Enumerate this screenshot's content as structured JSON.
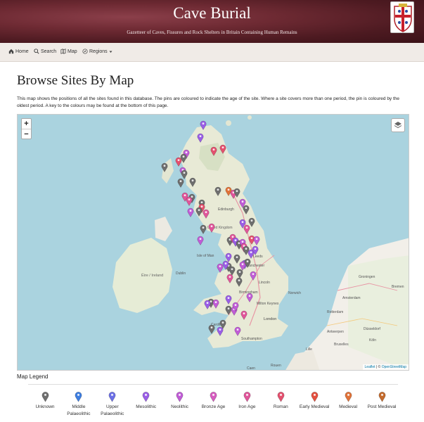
{
  "header": {
    "title": "Cave Burial",
    "subtitle": "Gazetteer of Caves, Fissures and Rock Shelters in Britain Containing Human Remains"
  },
  "nav": {
    "home": "Home",
    "search": "Search",
    "map": "Map",
    "regions": "Regions"
  },
  "page": {
    "title": "Browse Sites By Map",
    "intro": "This map shows the positions of all the sites found in this database. The pins are coloured to indicate the age of the site. Where a site covers more than one period, the pin is coloured by the oldest period. A key to the colours may be found at the bottom of this page."
  },
  "map": {
    "zoom_in": "+",
    "zoom_out": "−",
    "attribution_leaflet": "Leaflet",
    "attribution_sep": " | © ",
    "attribution_osm": "OpenStreetMap",
    "place_labels": [
      "Edinburgh",
      "United Kingdom",
      "Isle of Man",
      "Éire / Ireland",
      "Dublin",
      "Leeds",
      "Manchester",
      "Lincoln",
      "Birmingham",
      "Milton Keynes",
      "London",
      "Southampton",
      "Cardiff",
      "Norwich",
      "Groningen",
      "Bremen",
      "Amsterdam",
      "Rotterdam",
      "Antwerpen",
      "Bruxelles",
      "Düsseldorf",
      "Köln",
      "Lille",
      "Rouen",
      "Caen"
    ],
    "pins": [
      {
        "period": "mesolithic"
      },
      {
        "period": "mesolithic"
      },
      {
        "period": "roman"
      },
      {
        "period": "roman"
      },
      {
        "period": "unknown"
      },
      {
        "period": "roman"
      },
      {
        "period": "neolithic"
      },
      {
        "period": "unknown"
      },
      {
        "period": "neolithic"
      },
      {
        "period": "unknown"
      },
      {
        "period": "unknown"
      },
      {
        "period": "unknown"
      },
      {
        "period": "medieval"
      },
      {
        "period": "iron_age"
      },
      {
        "period": "unknown"
      },
      {
        "period": "iron_age"
      },
      {
        "period": "unknown"
      },
      {
        "period": "iron_age"
      },
      {
        "period": "unknown"
      },
      {
        "period": "neolithic"
      },
      {
        "period": "roman"
      },
      {
        "period": "unknown"
      },
      {
        "period": "iron_age"
      },
      {
        "period": "neolithic"
      },
      {
        "period": "unknown"
      },
      {
        "period": "unknown"
      },
      {
        "period": "unknown"
      },
      {
        "period": "neolithic"
      },
      {
        "period": "iron_age"
      },
      {
        "period": "mesolithic"
      },
      {
        "period": "unknown"
      },
      {
        "period": "iron_age"
      },
      {
        "period": "roman"
      },
      {
        "period": "neolithic"
      },
      {
        "period": "unknown"
      },
      {
        "period": "iron_age"
      },
      {
        "period": "mesolithic"
      },
      {
        "period": "unknown"
      },
      {
        "period": "neolithic"
      },
      {
        "period": "iron_age"
      },
      {
        "period": "unknown"
      },
      {
        "period": "mesolithic"
      },
      {
        "period": "mesolithic"
      },
      {
        "period": "unknown"
      },
      {
        "period": "unknown"
      },
      {
        "period": "neolithic"
      },
      {
        "period": "mesolithic"
      },
      {
        "period": "unknown"
      },
      {
        "period": "unknown"
      },
      {
        "period": "mesolithic"
      },
      {
        "period": "neolithic"
      },
      {
        "period": "neolithic"
      },
      {
        "period": "unknown"
      },
      {
        "period": "iron_age"
      },
      {
        "period": "mesolithic"
      },
      {
        "period": "unknown"
      },
      {
        "period": "neolithic"
      },
      {
        "period": "unknown"
      },
      {
        "period": "mesolithic"
      },
      {
        "period": "neolithic"
      },
      {
        "period": "mesolithic"
      },
      {
        "period": "unknown"
      },
      {
        "period": "neolithic"
      },
      {
        "period": "neolithic"
      },
      {
        "period": "iron_age"
      },
      {
        "period": "unknown"
      },
      {
        "period": "mesolithic"
      },
      {
        "period": "unknown"
      },
      {
        "period": "neolithic"
      }
    ]
  },
  "legend": {
    "title": "Map Legend",
    "items": [
      {
        "key": "unknown",
        "label": "Unknown",
        "color": "#6e6e6e"
      },
      {
        "key": "middle_palaeolithic",
        "label": "Middle Palaeolithic",
        "color": "#3d7de0"
      },
      {
        "key": "upper_palaeolithic",
        "label": "Upper Palaeolithic",
        "color": "#6b6fe6"
      },
      {
        "key": "mesolithic",
        "label": "Mesolithic",
        "color": "#9a5ee6"
      },
      {
        "key": "neolithic",
        "label": "Neolithic",
        "color": "#c05cd6"
      },
      {
        "key": "bronze_age",
        "label": "Bronze Age",
        "color": "#d65cbf"
      },
      {
        "key": "iron_age",
        "label": "Iron Age",
        "color": "#e0559a"
      },
      {
        "key": "roman",
        "label": "Roman",
        "color": "#e4506e"
      },
      {
        "key": "early_medieval",
        "label": "Early Medieval",
        "color": "#e4503f"
      },
      {
        "key": "medieval",
        "label": "Medieval",
        "color": "#e07238"
      },
      {
        "key": "post_medieval",
        "label": "Post Medieval",
        "color": "#c46a2c"
      }
    ]
  }
}
